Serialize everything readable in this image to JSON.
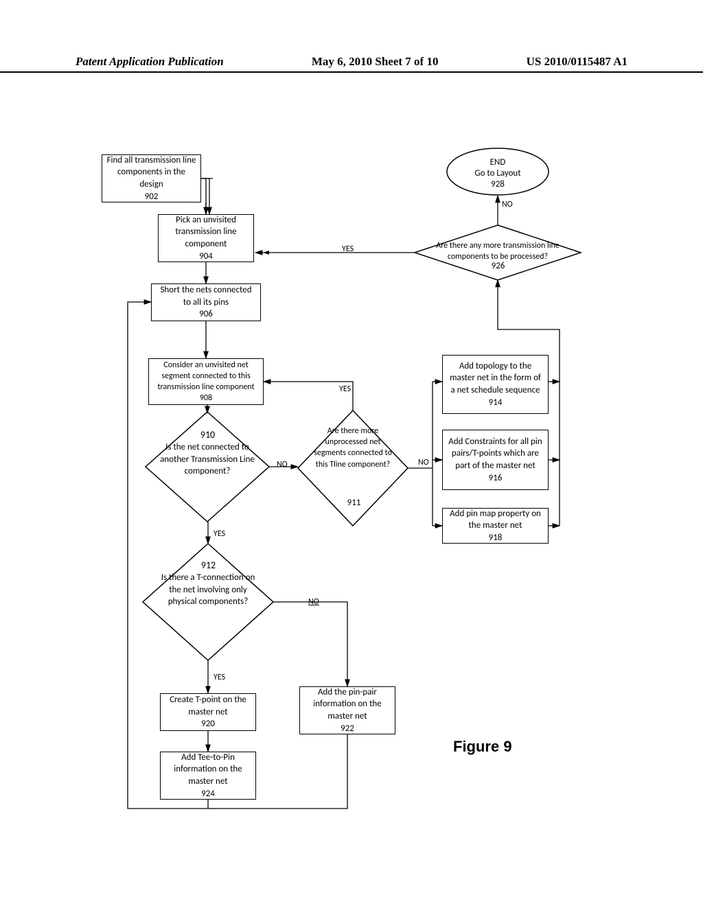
{
  "header": {
    "left": "Patent Application Publication",
    "center": "May 6, 2010  Sheet 7 of 10",
    "right": "US 2010/0115487 A1"
  },
  "nodes": {
    "n902": {
      "text": "Find all transmission line components in the design",
      "num": "902"
    },
    "n904": {
      "text": "Pick an unvisited transmission line component",
      "num": "904"
    },
    "n906": {
      "text": "Short the nets connected to all its pins",
      "num": "906"
    },
    "n908": {
      "text": "Consider an unvisited net segment connected to this transmission line component",
      "num": "908"
    },
    "n910": {
      "text": "Is the net connected to another Transmission Line component?",
      "num": "910"
    },
    "n911": {
      "text": "Are there more unprocessed net segments connected to this Tline component?",
      "num": "911"
    },
    "n912": {
      "text": "Is there a T-connection on the net involving only physical components?",
      "num": "912"
    },
    "n914": {
      "text": "Add topology to the master net in the form of a net schedule sequence",
      "num": "914"
    },
    "n916": {
      "text": "Add Constraints for all pin pairs/T-points which are part of the master net",
      "num": "916"
    },
    "n918": {
      "text": "Add pin map property on the master net",
      "num": "918"
    },
    "n920": {
      "text": "Create T-point on the master net",
      "num": "920"
    },
    "n922": {
      "text": "Add the pin-pair information on the master net",
      "num": "922"
    },
    "n924": {
      "text": "Add Tee-to-Pin information on the master net",
      "num": "924"
    },
    "n926": {
      "text": "Are there any more transmission line components to be processed?",
      "num": "926"
    },
    "n928": {
      "l1": "END",
      "l2": "Go to Layout",
      "num": "928"
    }
  },
  "labels": {
    "yes": "YES",
    "no": "NO"
  },
  "figure": "Figure 9"
}
